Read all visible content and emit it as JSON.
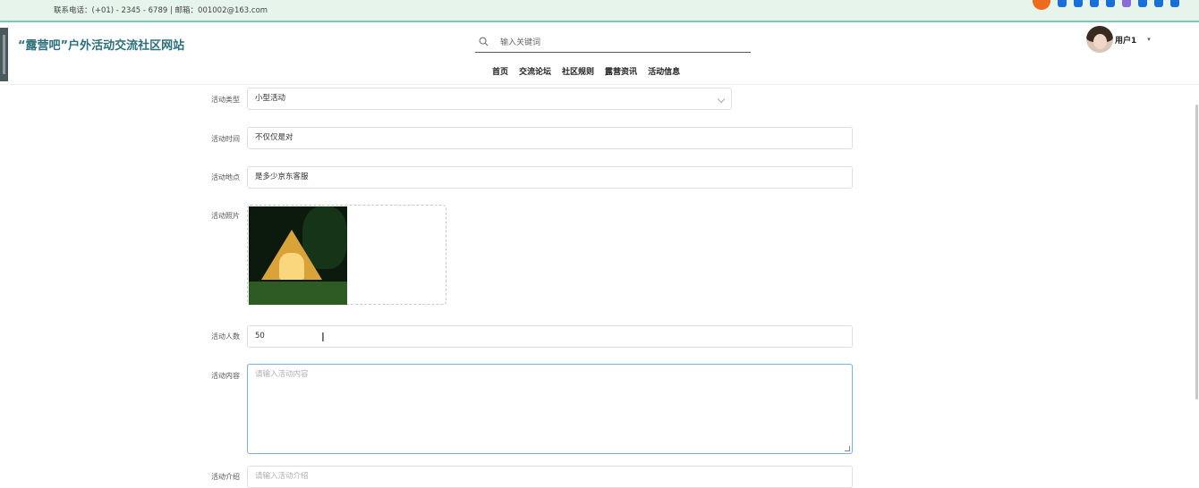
{
  "topbar": {
    "contact": "联系电话：(+01) - 2345 - 6789 | 邮箱：001002@163.com"
  },
  "header": {
    "brand": "“露营吧”户外活动交流社区网站",
    "search_placeholder": "输入关键词",
    "nav": [
      "首页",
      "交流论坛",
      "社区规则",
      "露营资讯",
      "活动信息"
    ],
    "user": {
      "name": "用户1",
      "caret": "▾"
    }
  },
  "form": {
    "type_label": "活动类型",
    "type_value": "小型活动",
    "time_label": "活动时间",
    "time_value": "不仅仅是对",
    "place_label": "活动地点",
    "place_value": "是多少京东客服",
    "photo_label": "活动照片",
    "count_label": "活动人数",
    "count_value": "50",
    "content_label": "活动内容",
    "content_placeholder": "请输入活动内容",
    "intro_label": "活动介绍",
    "intro_placeholder": "请输入活动介绍"
  },
  "colors": {
    "topbar_bg": "#e6f4ec",
    "brand": "#2c6f7a",
    "focus_border": "#7cb0e0"
  }
}
